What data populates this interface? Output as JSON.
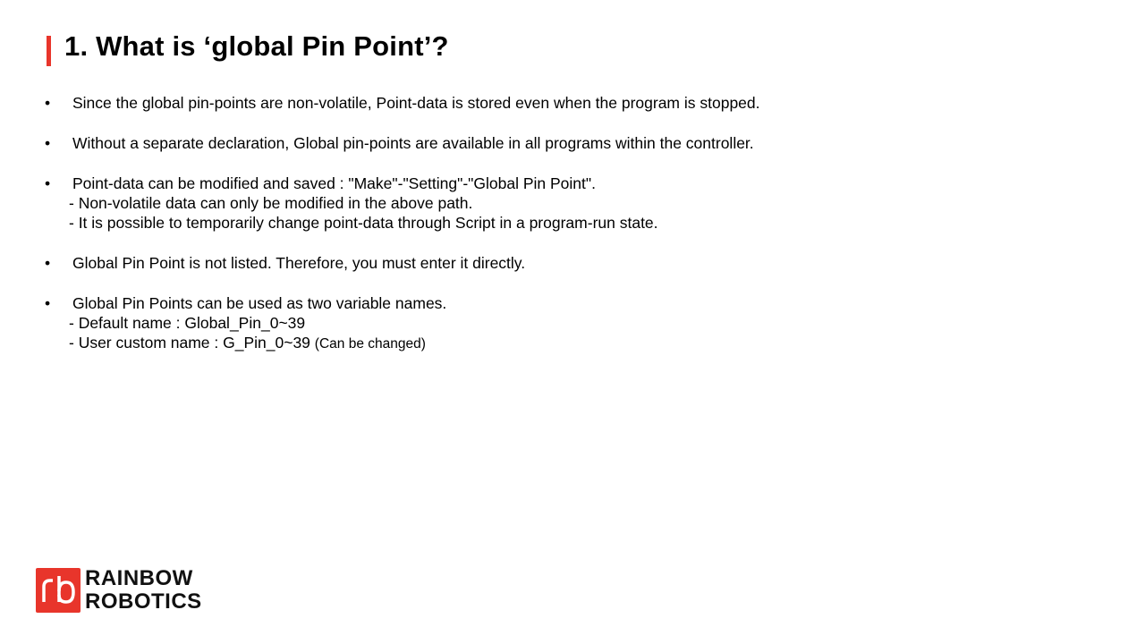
{
  "slide": {
    "title": "1. What is ‘global Pin Point’?",
    "accent_color": "#e8352b",
    "bullet_glyph": "•",
    "bullets": [
      {
        "text": "Since the global pin-points are non-volatile, Point-data is stored even when the program is stopped."
      },
      {
        "text": "Without a separate declaration, Global pin-points are available in all programs within the controller."
      },
      {
        "text": "Point-data can be modified and saved :   \"Make\"-\"Setting\"-\"Global Pin Point\".",
        "subs": [
          "- Non-volatile data can only be modified in the above path.",
          "- It is possible to temporarily change point-data through Script in a program-run state."
        ]
      },
      {
        "text": "Global Pin Point is not listed. Therefore, you must enter it directly."
      },
      {
        "text": "Global Pin Points can be used as two variable names.",
        "subs": [
          "- Default name : Global_Pin_0~39",
          "- User custom name : G_Pin_0~39"
        ],
        "sub_note": "(Can be changed)"
      }
    ]
  },
  "logo": {
    "line1": "RAINBOW",
    "line2": "ROBOTICS",
    "mark_icon": "rb-logo-icon",
    "brand_color": "#e8352b"
  }
}
